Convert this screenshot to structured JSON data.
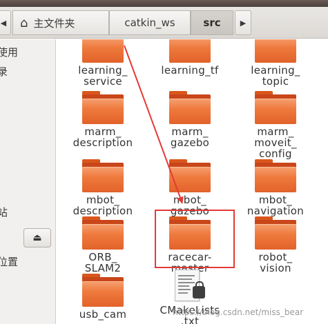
{
  "pathbar": {
    "home_label": "主文件夹",
    "crumbs": [
      "catkin_ws",
      "src"
    ],
    "home_icon": "home-icon",
    "back_icon": "triangle-left-icon",
    "forward_icon": "triangle-right-icon"
  },
  "sidebar": {
    "items": [
      "使用",
      "录",
      "站",
      "位置"
    ],
    "eject_icon": "eject-icon"
  },
  "files": [
    {
      "name": "learning_\nservice",
      "type": "folder"
    },
    {
      "name": "learning_tf",
      "type": "folder"
    },
    {
      "name": "learning_\ntopic",
      "type": "folder"
    },
    {
      "name": "marm_\ndescription",
      "type": "folder"
    },
    {
      "name": "marm_\ngazebo",
      "type": "folder"
    },
    {
      "name": "marm_\nmoveit_\nconfig",
      "type": "folder"
    },
    {
      "name": "mbot_\ndescription",
      "type": "folder"
    },
    {
      "name": "mbot_\ngazebo",
      "type": "folder"
    },
    {
      "name": "mbot_\nnavigation",
      "type": "folder"
    },
    {
      "name": "ORB_\nSLAM2",
      "type": "folder"
    },
    {
      "name": "racecar-\nmaster",
      "type": "folder"
    },
    {
      "name": "robot_\nvision",
      "type": "folder"
    },
    {
      "name": "usb_cam",
      "type": "folder"
    },
    {
      "name": "CMakeLists\n.txt",
      "type": "text-file"
    }
  ],
  "annotation": {
    "color": "#e53935",
    "highlighted": "racecar-\nmaster"
  },
  "watermark": "https://blog.csdn.net/miss_bear",
  "colors": {
    "folder_orange": "#ef7a3e",
    "pathbar_bg": "#e4e2df",
    "sidebar_bg": "#f1f0ee"
  }
}
